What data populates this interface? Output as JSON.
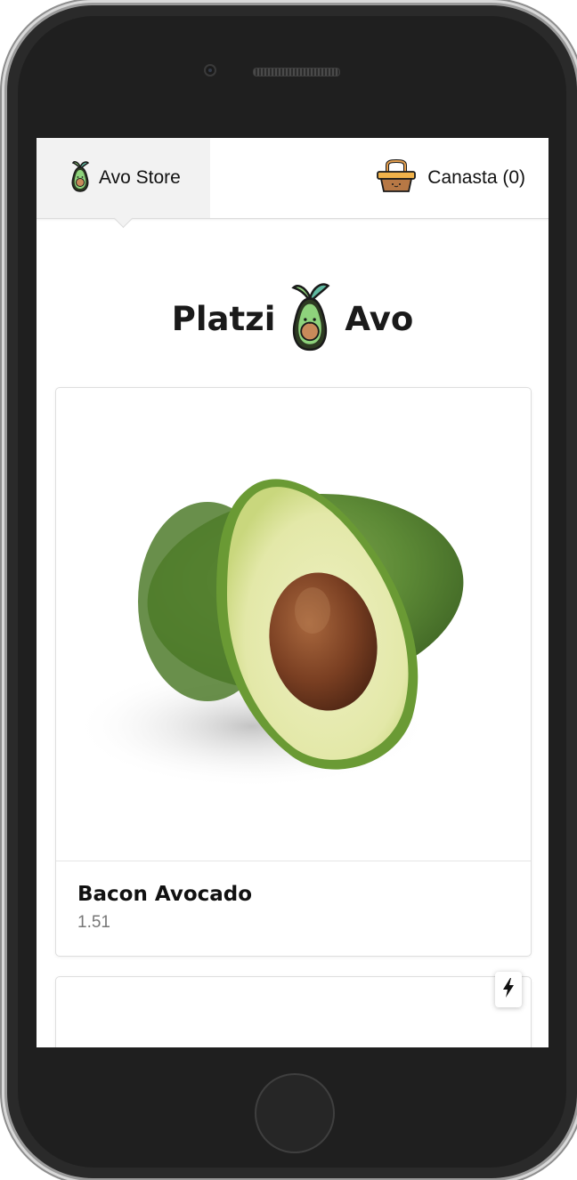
{
  "navbar": {
    "home_label": "Avo Store",
    "cart_label": "Canasta (0)"
  },
  "hero": {
    "left_word": "Platzi",
    "right_word": "Avo"
  },
  "products": [
    {
      "name": "Bacon Avocado",
      "price": "1.51"
    }
  ],
  "icons": {
    "home_icon": "avocado-mascot-icon",
    "cart_icon": "basket-icon",
    "hero_icon": "avocado-mascot-icon",
    "fab_icon": "lightning-bolt-icon"
  },
  "colors": {
    "nav_active_bg": "#f2f2f2",
    "avocado_green": "#7ec76a",
    "basket_brown": "#c9854a",
    "text_dark": "#111111",
    "price_gray": "#777777"
  }
}
